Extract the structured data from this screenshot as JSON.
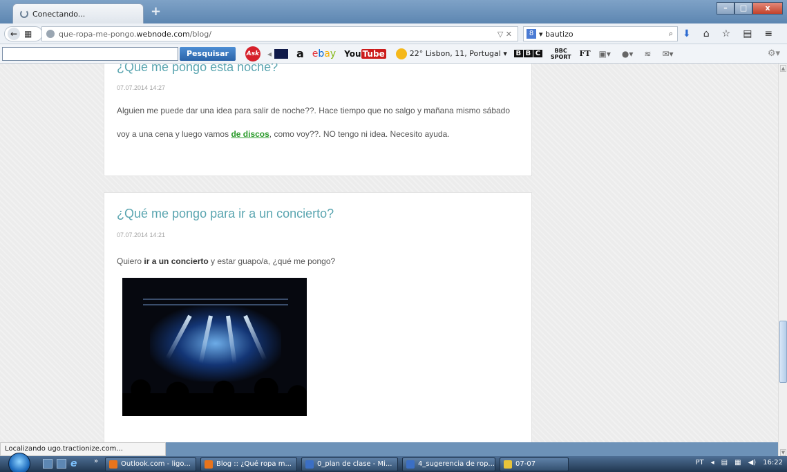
{
  "browser": {
    "tab_title": "Conectando...",
    "new_tab": "+",
    "window_controls": {
      "minimize": "–",
      "maximize": "□",
      "close": "x"
    },
    "url_prefix": "que-ropa-me-pongo.",
    "url_domain": "webnode.com",
    "url_path": "/blog/",
    "url_controls": "▽ ✕",
    "search_engine_badge": "8",
    "search_value": "▾ bautizo",
    "status_text": "Localizando ugo.tractionize.com..."
  },
  "toolbar": {
    "search_button": "Pesquisar",
    "ask_label": "Ask",
    "amazon_label": "a",
    "ebay": {
      "e": "e",
      "b": "b",
      "a": "a",
      "y": "y"
    },
    "youtube_prefix": "You",
    "youtube_suffix": "Tube",
    "weather": "22° Lisbon, 11, Portugal ▾",
    "bbc_letters": [
      "B",
      "B",
      "C"
    ],
    "bbc_sport_top": "BBC",
    "bbc_sport_bottom": "SPORT",
    "ft_label": "FT"
  },
  "posts": [
    {
      "title": "¿Qué me pongo ésta noche?",
      "date": "07.07.2014 14:27",
      "body_before_link": "Alguien me puede dar una idea para salir de noche??. Hace tiempo que no salgo y mañana mismo sábado voy a una cena y luego vamos ",
      "link_text": "de discos",
      "body_after_link": ", como voy??. NO tengo ni idea. Necesito ayuda."
    },
    {
      "title": "¿Qué me pongo para ir a un concierto?",
      "date": "07.07.2014 14:21",
      "body_before_bold": "Quiero ",
      "bold_text": "ir a un concierto",
      "body_after_bold": " y estar guapo/a, ¿qué me pongo?"
    }
  ],
  "taskbar": {
    "chevron": "»",
    "tasks": [
      {
        "label": "Outlook.com - ligo...",
        "icon_color": "#e8741c"
      },
      {
        "label": "Blog :: ¿Qué ropa m...",
        "icon_color": "#e8741c"
      },
      {
        "label": "0_plan de clase - Mi...",
        "icon_color": "#3b6fc4"
      },
      {
        "label": "4_sugerencia de rop...",
        "icon_color": "#3b6fc4"
      },
      {
        "label": "07-07",
        "icon_color": "#e8c43a"
      }
    ],
    "language": "PT",
    "clock": "16:22"
  }
}
